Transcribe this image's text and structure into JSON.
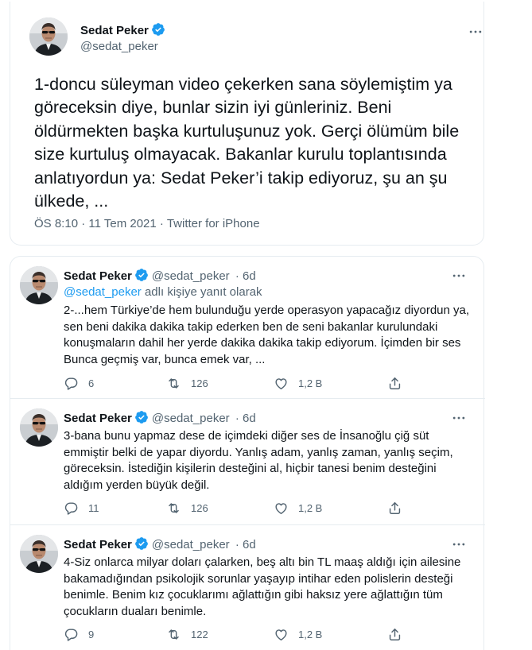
{
  "main_tweet": {
    "display_name": "Sedat Peker",
    "handle": "@sedat_peker",
    "text": "1-doncu süleyman video çekerken sana söylemiştim ya göreceksin diye, bunlar sizin iyi günleriniz. Beni öldürmekten başka kurtuluşunuz yok. Gerçi ölümüm bile size kurtuluş olmayacak. Bakanlar kurulu toplantısında anlatıyordun ya: Sedat Peker’i takip ediyoruz, şu an şu ülkede, ...",
    "time": "ÖS 8:10",
    "separator": "·",
    "date": "11 Tem 2021",
    "source": "Twitter for iPhone"
  },
  "replies": [
    {
      "display_name": "Sedat Peker",
      "handle": "@sedat_peker",
      "age": "· 6d",
      "replying_to_handle": "@sedat_peker",
      "replying_to_suffix": "adlı kişiye yanıt olarak",
      "text": "2-...hem Türkiye’de hem bulunduğu yerde operasyon yapacağız diyordun ya, sen beni dakika dakika takip ederken ben de seni bakanlar kurulundaki konuşmaların dahil her yerde dakika dakika takip ediyorum. İçimden bir ses Bunca geçmiş var, bunca emek var, ...",
      "replies_count": "6",
      "retweets_count": "126",
      "likes_count": "1,2 B"
    },
    {
      "display_name": "Sedat Peker",
      "handle": "@sedat_peker",
      "age": "· 6d",
      "text": "3-bana bunu yapmaz dese de içimdeki diğer ses de İnsanoğlu çiğ süt emmiştir belki de yapar diyordu. Yanlış adam, yanlış zaman, yanlış seçim, göreceksin. İstediğin kişilerin desteğini al, hiçbir tanesi benim desteğini aldığım yerden büyük değil.",
      "replies_count": "11",
      "retweets_count": "126",
      "likes_count": "1,2 B"
    },
    {
      "display_name": "Sedat Peker",
      "handle": "@sedat_peker",
      "age": "· 6d",
      "text": "4-Siz onlarca milyar doları çalarken, beş altı bin TL maaş aldığı için ailesine bakamadığından psikolojik sorunlar yaşayıp intihar eden polislerin desteği benimle. Benim kız çocuklarımı ağlattığın gibi haksız yere ağlattığın tüm çocukların duaları benimle.",
      "replies_count": "9",
      "retweets_count": "122",
      "likes_count": "1,2 B"
    }
  ],
  "colors": {
    "verified_badge": "#1d9bf0",
    "link": "#1d9bf0",
    "muted_text": "#536471",
    "border": "#e6ecf0"
  },
  "icons": [
    "verified-badge-icon",
    "more-options-icon",
    "reply-icon",
    "retweet-icon",
    "like-icon",
    "share-icon"
  ]
}
